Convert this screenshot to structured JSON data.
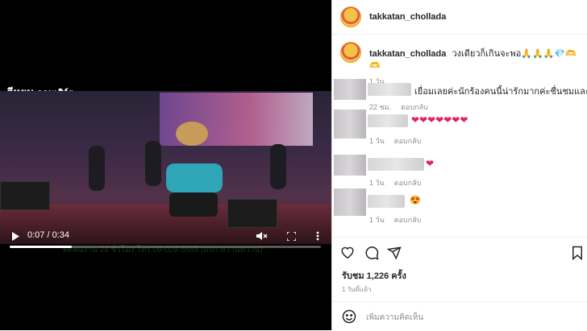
{
  "video": {
    "watermark_main": "ตีหยุน",
    "watermark_sub": "คอนเสิร์ต",
    "caption_ghost": "ติดต่องาน 24 ชั่วโมง โทร.09-028-5555 (ผจก.หวานหวาน)",
    "time": "0:07 / 0:34",
    "progress": 0.2
  },
  "post": {
    "username": "takkatan_chollada",
    "caption": "วงเดียวก็เกินจะพอ🙏🙏🙏💎🫶🫶",
    "age": "1 วัน"
  },
  "comments": [
    {
      "text": "เยื่อมเลยค่ะนักร้องคนนี้น่ารักมากค่ะชื่นชมและชื่นชอบค่ะ",
      "age": "22 ชม.",
      "reply": "ตอบกลับ"
    },
    {
      "text": "❤❤❤❤❤❤❤",
      "age": "1 วัน",
      "reply": "ตอบกลับ"
    },
    {
      "text": "❤",
      "age": "1 วัน",
      "reply": "ตอบกลับ"
    },
    {
      "text": "😍",
      "age": "1 วัน",
      "reply": "ตอบกลับ"
    }
  ],
  "stats": {
    "views": "รับชม 1,226 ครั้ง",
    "ago": "1 วันที่แล้ว"
  },
  "comment_box": {
    "placeholder": "เพิ่มความคิดเห็น"
  },
  "icons": [
    "play-icon",
    "volume-muted-icon",
    "fullscreen-icon",
    "more-icon",
    "heart-icon",
    "comment-icon",
    "share-icon",
    "bookmark-icon",
    "emoji-icon"
  ]
}
